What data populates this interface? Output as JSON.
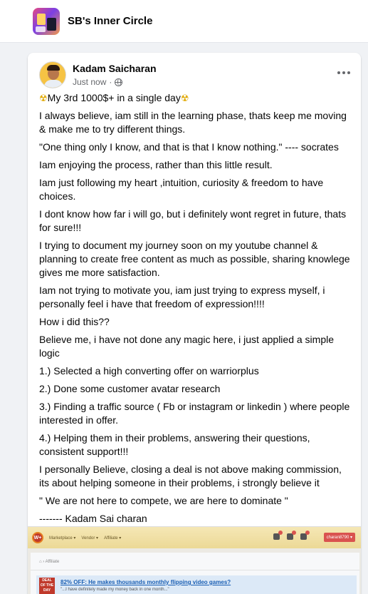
{
  "group": {
    "name": "SB's Inner Circle"
  },
  "post": {
    "author": "Kadam Saicharan",
    "time": "Just now",
    "separator": "·",
    "title_icon": "☢",
    "title_text": "My 3rd 1000$+ in a single day",
    "paragraphs": [
      "I always believe, iam still in the learning phase, thats keep me moving & make me to try different things.",
      "\"One thing only I know, and that is that I know nothing.\" ---- socrates",
      "Iam enjoying the process, rather than this little result.",
      "Iam just following my heart ,intuition, curiosity & freedom to have choices.",
      "I dont know how far i will go, but i definitely wont regret in future, thats for sure!!!",
      "I trying to document my journey soon on my youtube channel & planning to create free content as much as possible, sharing knowlege gives me more satisfaction.",
      "Iam not trying to motivate you, iam just trying to express myself, i personally feel i have that freedom of expression!!!!",
      "How i did this??",
      "Believe me, i have not done any magic here, i just applied a simple logic",
      "1.) Selected a high converting offer on warriorplus",
      "2.) Done some customer avatar research",
      "3.) Finding a traffic source ( Fb or instagram or linkedin ) where people interested in offer.",
      "4.) Helping them in their problems, answering their questions, consistent support!!!",
      "I personally Believe, closing a deal is not above making commission, its about helping someone in their problems, i strongly believe it",
      "\" We are not here to compete, we are here to dominate \"",
      "------- Kadam Sai charan"
    ]
  },
  "preview": {
    "logo": "W+",
    "menu": [
      "Marketplace ▾",
      "Vendor ▾",
      "Affiliate ▾"
    ],
    "user": "charan8790 ▾",
    "breadcrumb": "⌂ › Affiliate",
    "deal_badge": [
      "DEAL",
      "OF THE",
      "DAY"
    ],
    "deal_title": "82% OFF: He makes thousands monthly flipping video games?",
    "deal_quote": "\"...I have definitely made my money back in one month...\""
  },
  "icons": {
    "more": "more-options-icon",
    "privacy": "globe-icon"
  },
  "colors": {
    "page_bg": "#f0f2f5",
    "meta_text": "#65676b",
    "deal_link": "#1a5fb4"
  }
}
